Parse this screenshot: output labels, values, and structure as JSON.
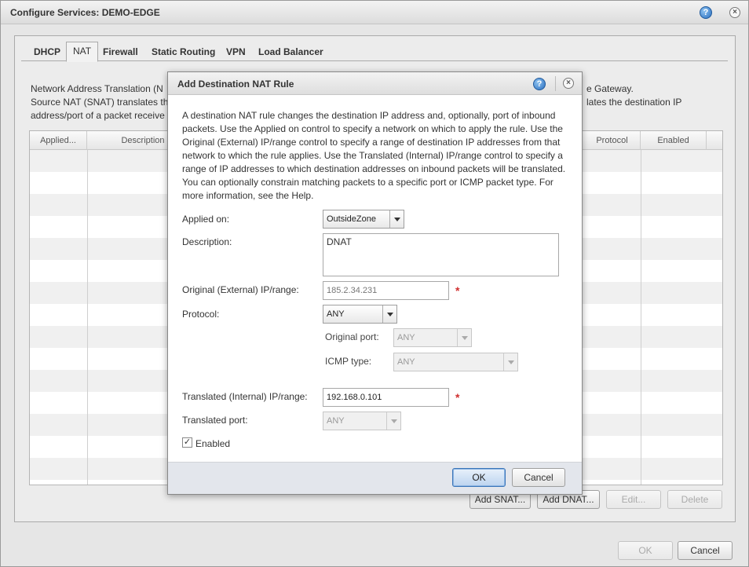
{
  "window": {
    "title": "Configure Services: DEMO-EDGE",
    "ok_label": "OK",
    "cancel_label": "Cancel"
  },
  "tabs": [
    {
      "label": "DHCP"
    },
    {
      "label": "NAT"
    },
    {
      "label": "Firewall"
    },
    {
      "label": "Static Routing"
    },
    {
      "label": "VPN"
    },
    {
      "label": "Load Balancer"
    }
  ],
  "nat": {
    "description_line1": "Network Address Translation (N",
    "description_line1_right": "e Gateway.",
    "description_line2": "Source NAT (SNAT) translates th",
    "description_line2_right": "lates the destination IP",
    "description_line3": "address/port of a packet receive",
    "columns": {
      "applied": "Applied...",
      "description": "Description",
      "protocol": "Protocol",
      "enabled": "Enabled"
    },
    "buttons": {
      "add_snat": "Add SNAT...",
      "add_dnat": "Add DNAT...",
      "edit": "Edit...",
      "delete": "Delete"
    }
  },
  "dialog": {
    "title": "Add Destination NAT Rule",
    "description": "A destination NAT rule changes the destination IP address and, optionally, port of inbound packets. Use the Applied on control to specify a network on which to apply the rule. Use the Original (External) IP/range control to specify a range of destination IP addresses from that network to which the rule applies. Use the Translated (Internal) IP/range control to specify a range of IP addresses to which destination addresses on inbound packets will be translated. You can optionally constrain matching packets to a specific port or ICMP packet type. For more information, see the Help.",
    "applied_on_label": "Applied on:",
    "applied_on_value": "OutsideZone",
    "description_label": "Description:",
    "description_value": "DNAT",
    "original_ip_label": "Original (External) IP/range:",
    "original_ip_value": "185.2.34.231",
    "protocol_label": "Protocol:",
    "protocol_value": "ANY",
    "original_port_label": "Original port:",
    "original_port_value": "ANY",
    "icmp_type_label": "ICMP type:",
    "icmp_type_value": "ANY",
    "translated_ip_label": "Translated (Internal) IP/range:",
    "translated_ip_value": "192.168.0.101",
    "translated_port_label": "Translated port:",
    "translated_port_value": "ANY",
    "enabled_label": "Enabled",
    "enabled_checked": "✓",
    "required_marker": "*",
    "ok_label": "OK",
    "cancel_label": "Cancel"
  },
  "icons": {
    "help": "?",
    "close": "×"
  }
}
